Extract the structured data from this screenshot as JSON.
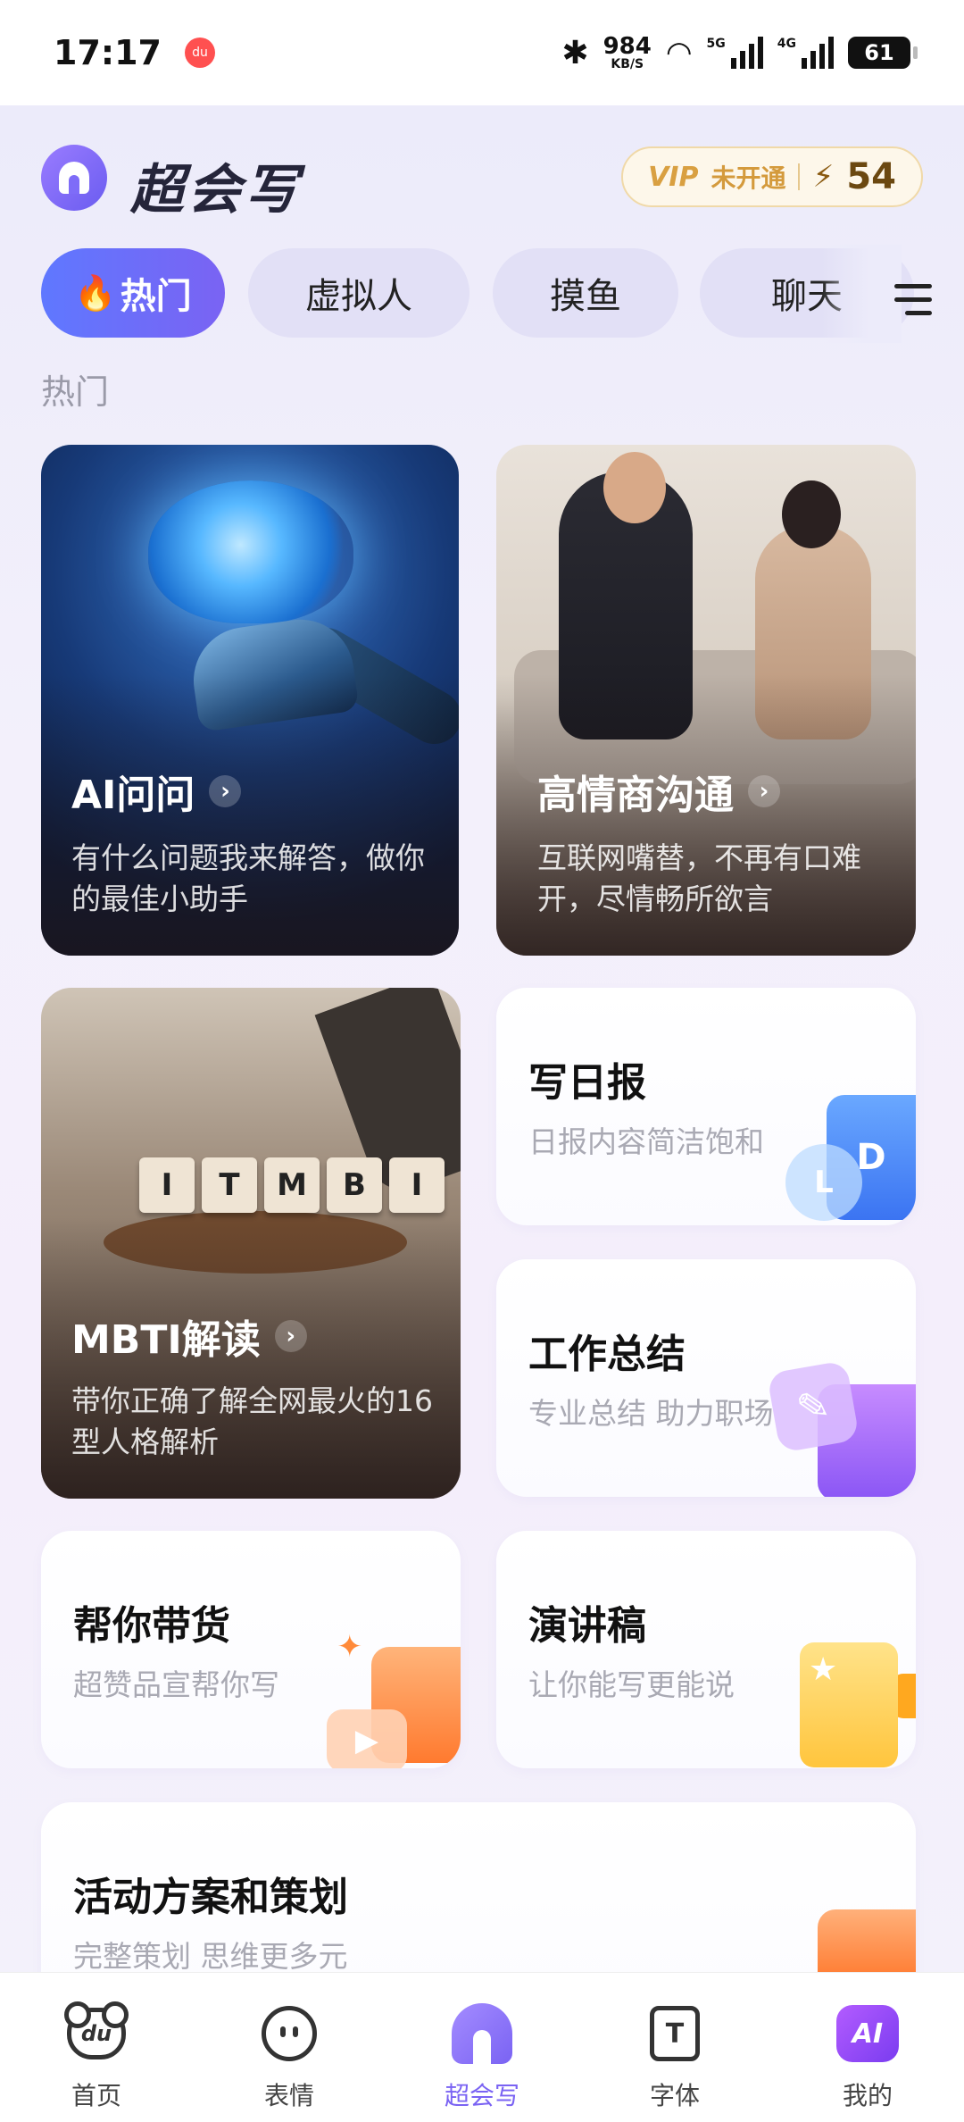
{
  "status_bar": {
    "time": "17:17",
    "notif_badge": "du",
    "net_speed_value": "984",
    "net_speed_unit": "KB/S",
    "signal1_label": "5G",
    "signal2_label": "4G",
    "battery": "61"
  },
  "header": {
    "app_title": "超会写",
    "vip_label": "VIP",
    "vip_status": "未开通",
    "points": "54"
  },
  "tabs": [
    {
      "label": "热门",
      "active": true
    },
    {
      "label": "虚拟人",
      "active": false
    },
    {
      "label": "摸鱼",
      "active": false
    },
    {
      "label": "聊天",
      "active": false
    }
  ],
  "section_label": "热门",
  "cards": {
    "ai": {
      "title": "AI问问",
      "desc": "有什么问题我来解答，做你的最佳小助手"
    },
    "eq": {
      "title": "高情商沟通",
      "desc": "互联网嘴替，不再有口难开，尽情畅所欲言"
    },
    "mbti": {
      "title": "MBTI解读",
      "desc": "带你正确了解全网最火的16型人格解析",
      "blocks": [
        "I",
        "T",
        "M",
        "B",
        "I"
      ]
    },
    "daily": {
      "title": "写日报",
      "desc": "日报内容简洁饱和",
      "icon_letters": [
        "D",
        "L"
      ]
    },
    "summary": {
      "title": "工作总结",
      "desc": "专业总结 助力职场"
    },
    "sales": {
      "title": "帮你带货",
      "desc": "超赞品宣帮你写"
    },
    "speech": {
      "title": "演讲稿",
      "desc": "让你能写更能说"
    },
    "event": {
      "title": "活动方案和策划",
      "desc": "完整策划 思维更多元"
    }
  },
  "bottom_nav": [
    {
      "label": "首页",
      "icon": "du-bear-icon",
      "icon_text": "du"
    },
    {
      "label": "表情",
      "icon": "emoji-face-icon"
    },
    {
      "label": "超会写",
      "icon": "chaohuixie-icon",
      "active": true
    },
    {
      "label": "字体",
      "icon": "font-t-icon",
      "icon_text": "T"
    },
    {
      "label": "我的",
      "icon": "ai-profile-icon",
      "icon_text": "AI"
    }
  ],
  "colors": {
    "accent": "#7a63f3",
    "tab_active_start": "#5f78ff",
    "vip_gold": "#d9a041"
  }
}
